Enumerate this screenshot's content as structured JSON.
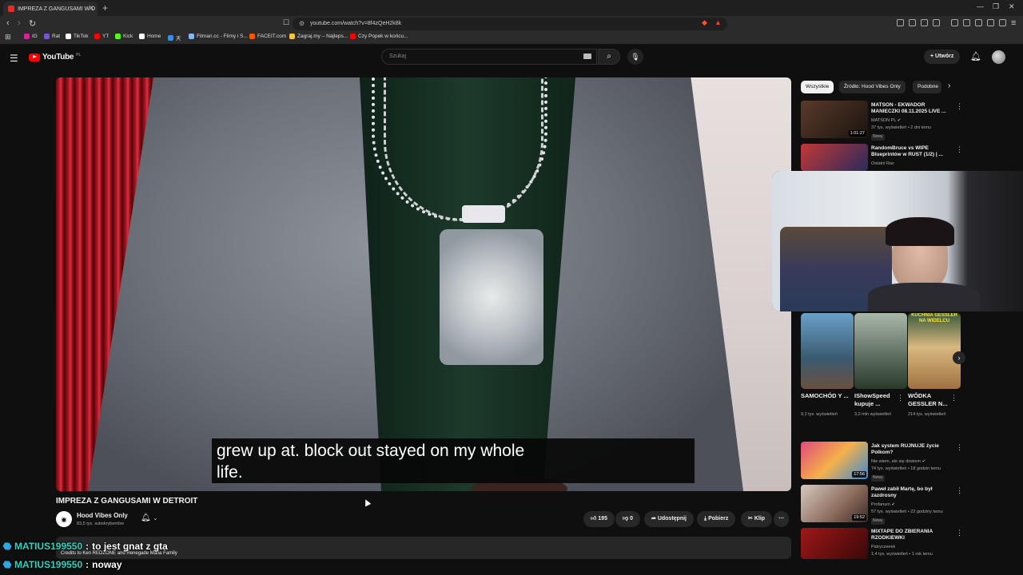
{
  "browser": {
    "tab_title": "IMPREZA Z GANGUSAMI W D",
    "url": "youtube.com/watch?v=8f4zQeH2k8k",
    "bookmarks": [
      {
        "label": "IG",
        "color": "#d6249f"
      },
      {
        "label": "Rat",
        "color": "#7a52d8"
      },
      {
        "label": "TikTok",
        "color": "#ffffff"
      },
      {
        "label": "YT",
        "color": "#ff0000"
      },
      {
        "label": "Kick",
        "color": "#53fc18"
      },
      {
        "label": "Home",
        "color": "#ffffff"
      },
      {
        "label": "天",
        "color": "#3a8de0"
      },
      {
        "label": "Filman.cc - Filmy i S...",
        "color": "#8ab4f8"
      },
      {
        "label": "FACEIT.com",
        "color": "#ff5500"
      },
      {
        "label": "Zagraj.my – Najleps...",
        "color": "#f4c542"
      },
      {
        "label": "Czy Popek w końcu...",
        "color": "#ff0000"
      }
    ]
  },
  "youtube": {
    "logo_text": "YouTube",
    "country": "PL",
    "search_placeholder": "Szukaj",
    "create_label": "Utwórz"
  },
  "video": {
    "caption": "grew up at. block out stayed on my whole\nlife.",
    "title": "IMPREZA Z GANGUSAMI W DETROIT",
    "channel": "Hood Vibes Only",
    "subscribers": "83,5 tys. subskrybentów",
    "likes": "195",
    "dislikes": "0",
    "share_label": "Udostępnij",
    "download_label": "Pobierz",
    "clip_label": "Klip",
    "description_credit": "Credits to Ken REDZONE and Renegade Mafia Family"
  },
  "sidebar": {
    "chips": [
      {
        "label": "Wszystkie",
        "active": true
      },
      {
        "label": "Źródło: Hood Vibes Only",
        "active": false
      },
      {
        "label": "Podobne",
        "active": false
      }
    ],
    "recs": [
      {
        "title": "MATSON - EKWADOR MANIECZKI 08.11.2025 LIVE ...",
        "channel": "MATSON PL",
        "meta": "37 tys. wyświetleń • 2 dni temu",
        "badge": "Nowy",
        "duration": "1:01:27",
        "thumb": "#3b2a22"
      },
      {
        "title": "RandomBruce vs WIPE Blueprintów w RUST (1/2) | ...",
        "channel": "Ostatni Raz",
        "meta": "",
        "badge": "",
        "duration": "",
        "thumb": "#3a3a6a"
      },
      {
        "title": "Jak system RUJNUJE życie Polkom?",
        "channel": "Nie wiem, ale się dowiem",
        "meta": "74 tys. wyświetleń • 18 godzin temu",
        "badge": "Nowy",
        "duration": "17:56",
        "thumb": "#c85a7a"
      },
      {
        "title": "Paweł zabił Martę, bo był zazdrosny",
        "channel": "Profanum",
        "meta": "57 tys. wyświetleń • 22 godziny temu",
        "badge": "Nowy",
        "duration": "19:52",
        "thumb": "#8a6a5a"
      },
      {
        "title": "MIXTAPE DO ZBIERANIA RZODKIEWKI",
        "channel": "Patryczeeek",
        "meta": "1,4 tys. wyświetleń • 1 rok temu",
        "badge": "",
        "duration": "",
        "thumb": "#7a1010"
      }
    ],
    "shorts": [
      {
        "title": "SAMOCHÓD Y ...",
        "meta": "9,2 tys. wyświetleń",
        "thumb": "#4a7aa0"
      },
      {
        "title": "IShowSpeed kupuje ...",
        "meta": "3,2 mln wyświetleń",
        "thumb": "#8a9a8a"
      },
      {
        "title": "WÓDKA GESSLER N...",
        "meta": "214 tys. wyświetleń",
        "thumb": "#b89060"
      }
    ],
    "shorts_overlay_text": "KUCHNIA GESSLER NA WIDELCU"
  },
  "chat": [
    {
      "user": "MATIUS199550",
      "message": "to jest gnat z gta"
    },
    {
      "user": "MATIUS199550",
      "message": "noway"
    }
  ]
}
